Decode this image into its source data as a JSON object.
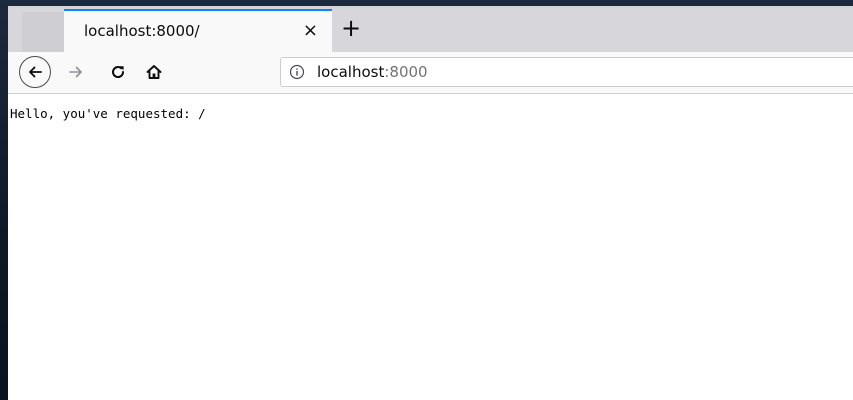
{
  "browser": {
    "tab": {
      "title": "localhost:8000/",
      "close_glyph": "×",
      "close_icon": "close-icon"
    },
    "new_tab": {
      "glyph": "+",
      "icon": "plus-icon"
    },
    "nav": {
      "back_icon": "arrow-left-icon",
      "forward_icon": "arrow-right-icon",
      "reload_icon": "reload-icon",
      "home_icon": "home-icon"
    },
    "urlbar": {
      "info_icon": "info-icon",
      "host": "localhost",
      "port": ":8000"
    },
    "colors": {
      "tab_accent": "#0a84ff",
      "tabstrip_bg": "#d7d7db",
      "toolbar_bg": "#f9f9fa"
    }
  },
  "page": {
    "text": "Hello, you've requested: /"
  }
}
